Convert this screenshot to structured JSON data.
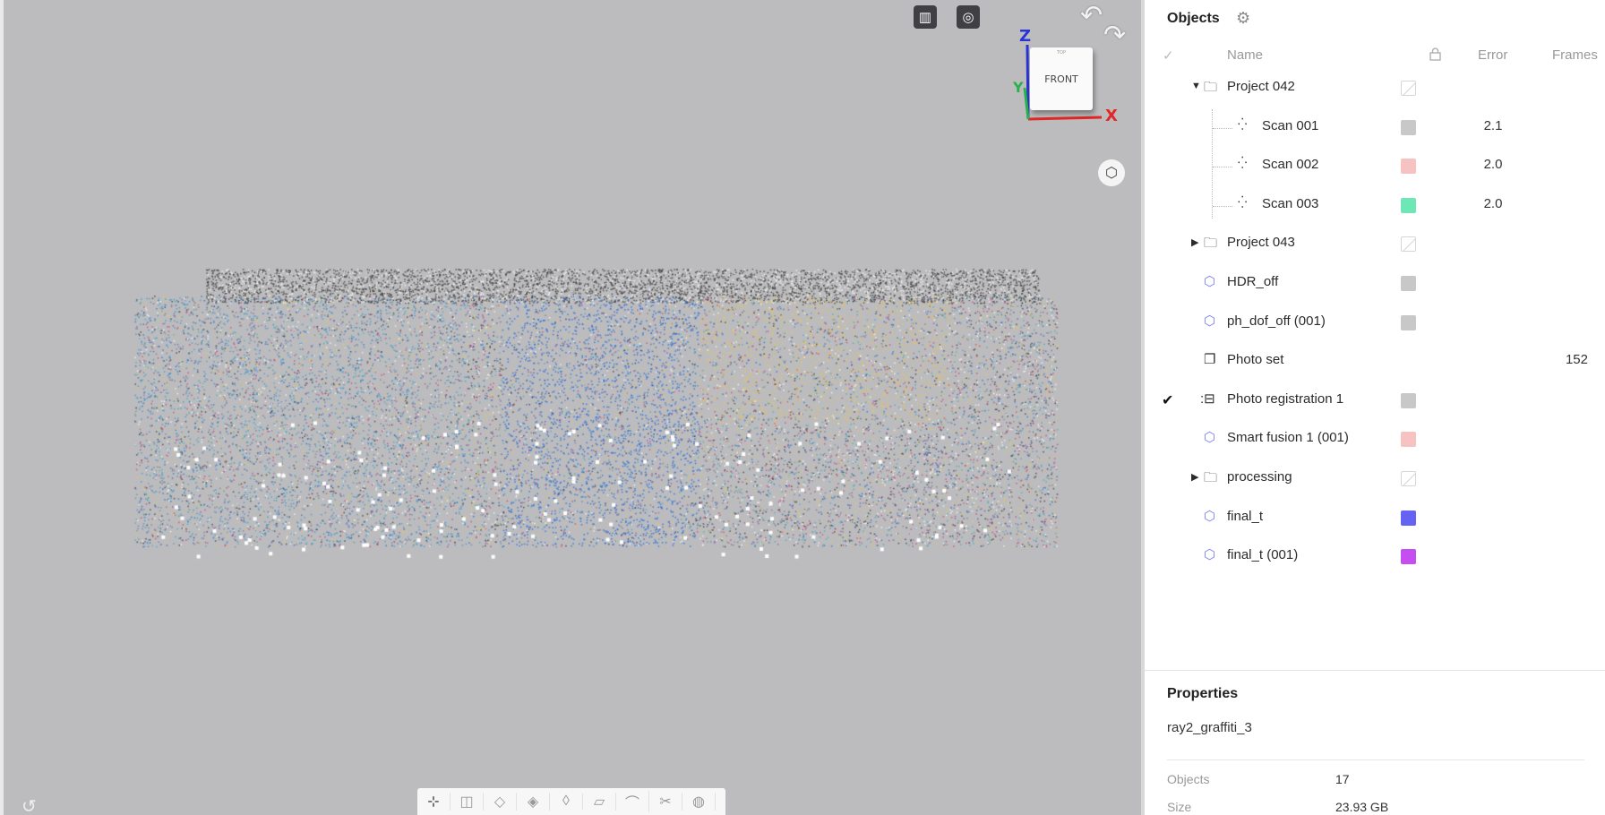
{
  "viewport": {
    "toolbar_top": [
      {
        "name": "perspective-icon",
        "glyph": "▥"
      },
      {
        "name": "focus-icon",
        "glyph": "◎"
      }
    ],
    "gizmo": {
      "face_label": "FRONT",
      "top_label": "TOP",
      "x": "X",
      "y": "Y",
      "z": "Z"
    },
    "bottom_toolbar": [
      {
        "name": "move-tool-icon",
        "glyph": "⊹",
        "active": true
      },
      {
        "name": "box-view-icon",
        "glyph": "◫"
      },
      {
        "name": "left-view-icon",
        "glyph": "◇"
      },
      {
        "name": "right-view-icon",
        "glyph": "◈"
      },
      {
        "name": "front-view-icon",
        "glyph": "◊"
      },
      {
        "name": "back-view-icon",
        "glyph": "▱"
      },
      {
        "name": "lasso-icon",
        "glyph": "⌒"
      },
      {
        "name": "cut-icon",
        "glyph": "✂"
      },
      {
        "name": "orbit-icon",
        "glyph": "◍"
      }
    ]
  },
  "panel": {
    "title": "Objects",
    "columns": {
      "name": "Name",
      "error": "Error",
      "frames": "Frames"
    },
    "rows": [
      {
        "label": "Project 042",
        "type": "folder",
        "expanded": true,
        "swatch": "empty",
        "error": "",
        "frames": "",
        "checked": false
      },
      {
        "label": "Scan 001",
        "type": "scan",
        "swatch": "#c8c8c8",
        "error": "2.1",
        "frames": "",
        "checked": false
      },
      {
        "label": "Scan 002",
        "type": "scan",
        "swatch": "#f6c2c2",
        "error": "2.0",
        "frames": "",
        "checked": false
      },
      {
        "label": "Scan 003",
        "type": "scan",
        "swatch": "#6ee7b7",
        "error": "2.0",
        "frames": "",
        "checked": false
      },
      {
        "label": "Project 043",
        "type": "folder",
        "expanded": false,
        "swatch": "empty",
        "error": "",
        "frames": "",
        "checked": false
      },
      {
        "label": "HDR_off",
        "type": "object",
        "swatch": "#c8c8c8",
        "error": "",
        "frames": "",
        "checked": false
      },
      {
        "label": "ph_dof_off (001)",
        "type": "object",
        "swatch": "#c8c8c8",
        "error": "",
        "frames": "",
        "checked": false
      },
      {
        "label": "Photo set",
        "type": "photo",
        "swatch": "none",
        "error": "",
        "frames": "152",
        "checked": false
      },
      {
        "label": "Photo registration 1",
        "type": "registration",
        "swatch": "#c8c8c8",
        "error": "",
        "frames": "",
        "checked": true
      },
      {
        "label": "Smart fusion 1 (001)",
        "type": "object",
        "swatch": "#f6c2c2",
        "error": "",
        "frames": "",
        "checked": false
      },
      {
        "label": "processing",
        "type": "folder",
        "expanded": false,
        "swatch": "empty",
        "error": "",
        "frames": "",
        "checked": false
      },
      {
        "label": "final_t",
        "type": "object",
        "swatch": "#6563f2",
        "error": "",
        "frames": "",
        "checked": false
      },
      {
        "label": "final_t (001)",
        "type": "object",
        "swatch": "#c54ef0",
        "error": "",
        "frames": "",
        "checked": false
      }
    ]
  },
  "properties": {
    "title": "Properties",
    "name": "ray2_graffiti_3",
    "items": [
      {
        "label": "Objects",
        "value": "17"
      },
      {
        "label": "Size",
        "value": "23.93 GB"
      }
    ]
  }
}
